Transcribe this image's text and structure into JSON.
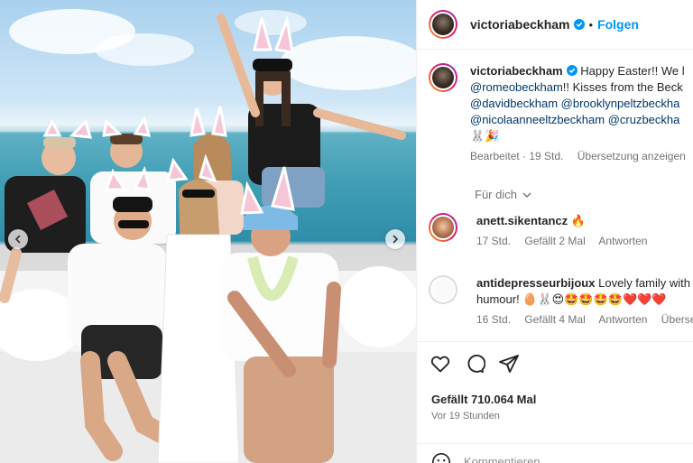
{
  "post": {
    "username": "victoriabeckham",
    "follow_label": "Folgen",
    "separator": "•"
  },
  "caption": {
    "username": "victoriabeckham",
    "line1": "Happy Easter!! We l",
    "line2_mention": "@romeobeckham",
    "line2_text": "!! Kisses from the Beck",
    "line3_a": "@davidbeckham",
    "line3_b": "@brooklynpeltzbeckha",
    "line4_a": "@nicolaanneeltzbeckham",
    "line4_b": "@cruzbeckha",
    "line5_emoji": "🐰🎉",
    "edited": "Bearbeitet · 19 Std.",
    "translate": "Übersetzung anzeigen"
  },
  "for_you": "Für dich",
  "comments": [
    {
      "username": "anett.sikentancz",
      "text": "🔥",
      "time": "17 Std.",
      "likes": "Gefällt 2 Mal",
      "reply": "Antworten"
    },
    {
      "username": "antidepresseurbijoux",
      "text": "Lovely family with",
      "text2": "humour! 🥚🐰😍🤩🤩🤩🤩❤️❤️❤️",
      "time": "16 Std.",
      "likes": "Gefällt 4 Mal",
      "reply": "Antworten",
      "translate": "Übersetzu"
    }
  ],
  "stats": {
    "likes": "Gefällt 710.064 Mal",
    "posted": "Vor 19 Stunden"
  },
  "composer": {
    "placeholder": "Kommentieren ..."
  },
  "icons": [
    "heart-icon",
    "comment-icon",
    "share-icon",
    "emoji-icon",
    "chevron-left-icon",
    "chevron-right-icon",
    "chevron-down-icon",
    "verified-icon"
  ],
  "colors": {
    "link": "#00376b",
    "accent": "#0095f6",
    "muted": "#737373"
  }
}
